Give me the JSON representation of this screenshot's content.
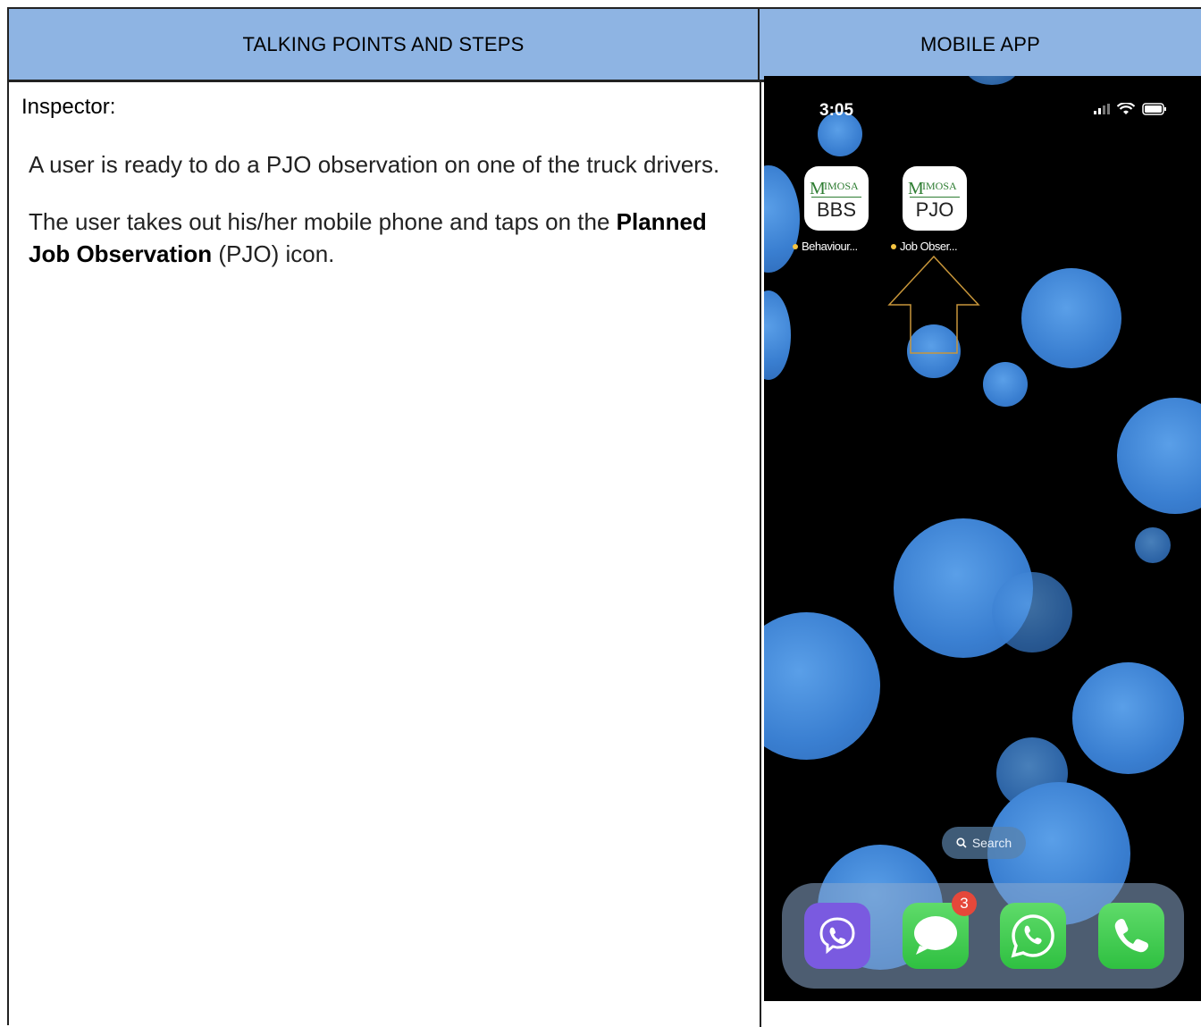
{
  "headers": {
    "left": "TALKING POINTS AND STEPS",
    "right": "MOBILE APP"
  },
  "content": {
    "role": "Inspector:",
    "para1": "A user is ready to do a PJO observation on one of the truck drivers.",
    "para2_pre": "The user takes out his/her mobile phone and taps on the ",
    "para2_bold": "Planned Job Observation",
    "para2_post": " (PJO) icon."
  },
  "phone": {
    "time": "3:05",
    "apps": [
      {
        "brand_m": "M",
        "brand_rest": "IMOSA",
        "code": "BBS",
        "label": "Behaviour..."
      },
      {
        "brand_m": "M",
        "brand_rest": "IMOSA",
        "code": "PJO",
        "label": "Job Obser..."
      }
    ],
    "search_label": "Search",
    "dock": [
      "viber-app",
      "messages-app",
      "whatsapp-app",
      "phone-app"
    ],
    "messages_badge": "3",
    "colors": {
      "bokeh": "#3a7fd1",
      "arrow": "#c8963a",
      "badge": "#e5483a",
      "header": "#8eb4e3"
    }
  }
}
